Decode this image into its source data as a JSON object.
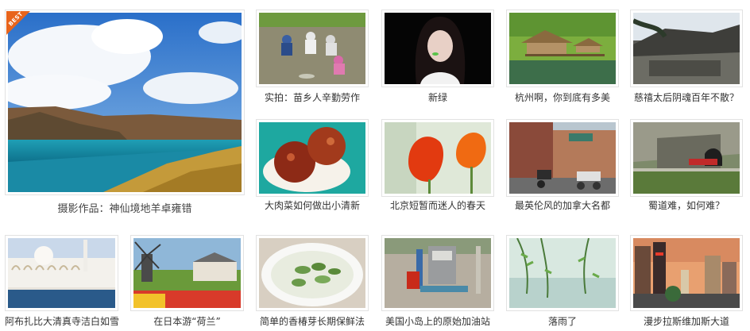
{
  "featured": {
    "badge": "BEST",
    "caption": "摄影作品：神仙境地羊卓雍错"
  },
  "row1": [
    {
      "caption": "实拍：苗乡人辛勤劳作"
    },
    {
      "caption": "新绿"
    },
    {
      "caption": "杭州啊，你到底有多美"
    },
    {
      "caption": "慈禧太后阴魂百年不散？"
    }
  ],
  "row2": [
    {
      "caption": "大肉菜如何做出小清新"
    },
    {
      "caption": "北京短暂而迷人的春天"
    },
    {
      "caption": "最英伦风的加拿大名都"
    },
    {
      "caption": "蜀道难，如何难？"
    }
  ],
  "row3": [
    {
      "caption": "阿布扎比大清真寺洁白如雪"
    },
    {
      "caption": "在日本游“荷兰”"
    },
    {
      "caption": "简单的香椿芽长期保鲜法"
    },
    {
      "caption": "美国小岛上的原始加油站"
    },
    {
      "caption": "落雨了"
    },
    {
      "caption": "漫步拉斯维加斯大道"
    }
  ]
}
